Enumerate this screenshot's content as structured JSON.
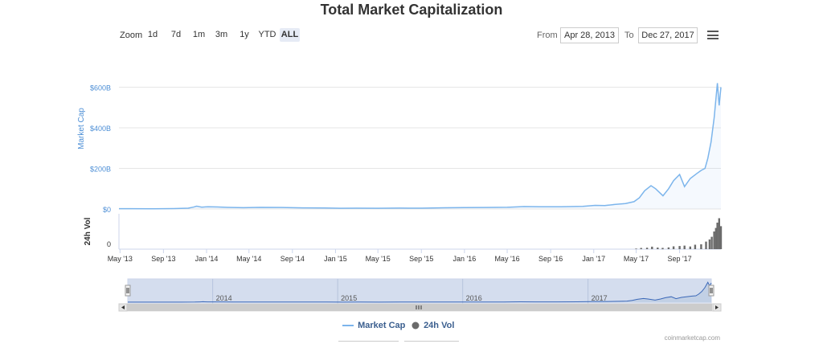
{
  "chart_data": {
    "type": "area",
    "title": "Total Market Capitalization",
    "series": [
      {
        "name": "Market Cap",
        "color": "#7cb5ec",
        "unit": "USD billions",
        "points": [
          [
            "2013-04-28",
            1.5
          ],
          [
            "2013-06-01",
            1.4
          ],
          [
            "2013-08-01",
            1.3
          ],
          [
            "2013-10-01",
            2.0
          ],
          [
            "2013-11-10",
            4
          ],
          [
            "2013-11-25",
            9
          ],
          [
            "2013-12-04",
            14
          ],
          [
            "2013-12-18",
            9
          ],
          [
            "2014-01-05",
            11
          ],
          [
            "2014-02-01",
            10
          ],
          [
            "2014-03-01",
            8
          ],
          [
            "2014-04-15",
            6.5
          ],
          [
            "2014-06-01",
            8
          ],
          [
            "2014-08-01",
            7.5
          ],
          [
            "2014-10-01",
            5.5
          ],
          [
            "2014-12-01",
            5.2
          ],
          [
            "2015-01-15",
            3.5
          ],
          [
            "2015-03-01",
            4
          ],
          [
            "2015-05-01",
            3.6
          ],
          [
            "2015-07-01",
            4.3
          ],
          [
            "2015-09-01",
            3.9
          ],
          [
            "2015-11-05",
            5.8
          ],
          [
            "2016-01-01",
            7
          ],
          [
            "2016-03-01",
            7.5
          ],
          [
            "2016-05-01",
            8.5
          ],
          [
            "2016-06-18",
            12
          ],
          [
            "2016-08-01",
            10.5
          ],
          [
            "2016-10-01",
            11
          ],
          [
            "2016-12-01",
            13
          ],
          [
            "2017-01-05",
            18
          ],
          [
            "2017-02-01",
            17
          ],
          [
            "2017-03-01",
            22
          ],
          [
            "2017-04-01",
            27
          ],
          [
            "2017-04-25",
            36
          ],
          [
            "2017-05-10",
            55
          ],
          [
            "2017-05-25",
            90
          ],
          [
            "2017-06-12",
            115
          ],
          [
            "2017-06-25",
            100
          ],
          [
            "2017-07-16",
            65
          ],
          [
            "2017-08-01",
            100
          ],
          [
            "2017-08-15",
            140
          ],
          [
            "2017-09-01",
            170
          ],
          [
            "2017-09-15",
            110
          ],
          [
            "2017-10-01",
            150
          ],
          [
            "2017-10-20",
            175
          ],
          [
            "2017-11-01",
            190
          ],
          [
            "2017-11-12",
            200
          ],
          [
            "2017-11-20",
            250
          ],
          [
            "2017-11-29",
            330
          ],
          [
            "2017-12-08",
            450
          ],
          [
            "2017-12-17",
            620
          ],
          [
            "2017-12-22",
            510
          ],
          [
            "2017-12-27",
            600
          ]
        ]
      },
      {
        "name": "24h Vol",
        "color": "#6b6b6b",
        "unit": "USD billions",
        "points": [
          [
            "2017-05-01",
            0.6
          ],
          [
            "2017-05-15",
            1.4
          ],
          [
            "2017-06-01",
            1.6
          ],
          [
            "2017-06-15",
            2.8
          ],
          [
            "2017-07-01",
            1.8
          ],
          [
            "2017-07-15",
            1.5
          ],
          [
            "2017-08-01",
            2.0
          ],
          [
            "2017-08-15",
            3.2
          ],
          [
            "2017-09-01",
            3.5
          ],
          [
            "2017-09-15",
            4.0
          ],
          [
            "2017-10-01",
            3.0
          ],
          [
            "2017-10-15",
            5.0
          ],
          [
            "2017-11-01",
            5.5
          ],
          [
            "2017-11-15",
            8.5
          ],
          [
            "2017-11-25",
            11
          ],
          [
            "2017-12-01",
            14
          ],
          [
            "2017-12-08",
            20
          ],
          [
            "2017-12-13",
            24
          ],
          [
            "2017-12-17",
            30
          ],
          [
            "2017-12-22",
            35
          ],
          [
            "2017-12-27",
            26
          ]
        ]
      }
    ],
    "ylabel": "Market Cap",
    "ylim": [
      0,
      650
    ],
    "y_ticks": [
      "$0",
      "$200B",
      "$400B",
      "$600B"
    ],
    "y_tick_values": [
      0,
      200,
      400,
      600
    ],
    "vol_ylabel": "24h Vol",
    "vol_ylim": [
      0,
      40
    ],
    "vol_tick": "0",
    "x_ticks": [
      "May '13",
      "Sep '13",
      "Jan '14",
      "May '14",
      "Sep '14",
      "Jan '15",
      "May '15",
      "Sep '15",
      "Jan '16",
      "May '16",
      "Sep '16",
      "Jan '17",
      "May '17",
      "Sep '17"
    ],
    "x_tick_dates": [
      "2013-05-01",
      "2013-09-01",
      "2014-01-01",
      "2014-05-01",
      "2014-09-01",
      "2015-01-01",
      "2015-05-01",
      "2015-09-01",
      "2016-01-01",
      "2016-05-01",
      "2016-09-01",
      "2017-01-01",
      "2017-05-01",
      "2017-09-01"
    ],
    "x_range": [
      "2013-04-28",
      "2017-12-27"
    ],
    "grid": true,
    "legend": "bottom-center"
  },
  "zoom": {
    "label": "Zoom",
    "buttons": [
      "1d",
      "7d",
      "1m",
      "3m",
      "1y",
      "YTD",
      "ALL"
    ],
    "active": "ALL"
  },
  "range": {
    "from_label": "From",
    "from_value": "Apr 28, 2013",
    "to_label": "To",
    "to_value": "Dec 27, 2017"
  },
  "navigator": {
    "year_labels": [
      "2014",
      "2015",
      "2016",
      "2017"
    ],
    "year_dates": [
      "2014-01-01",
      "2015-01-01",
      "2016-01-01",
      "2017-01-01"
    ]
  },
  "legend": {
    "market_cap": "Market Cap",
    "vol": "24h Vol"
  },
  "credits": "coinmarketcap.com",
  "icons": {
    "menu": "hamburger-icon",
    "navigator_left": "chevron-left-icon",
    "navigator_right": "chevron-right-icon",
    "scroll_grip": "grip-icon"
  }
}
